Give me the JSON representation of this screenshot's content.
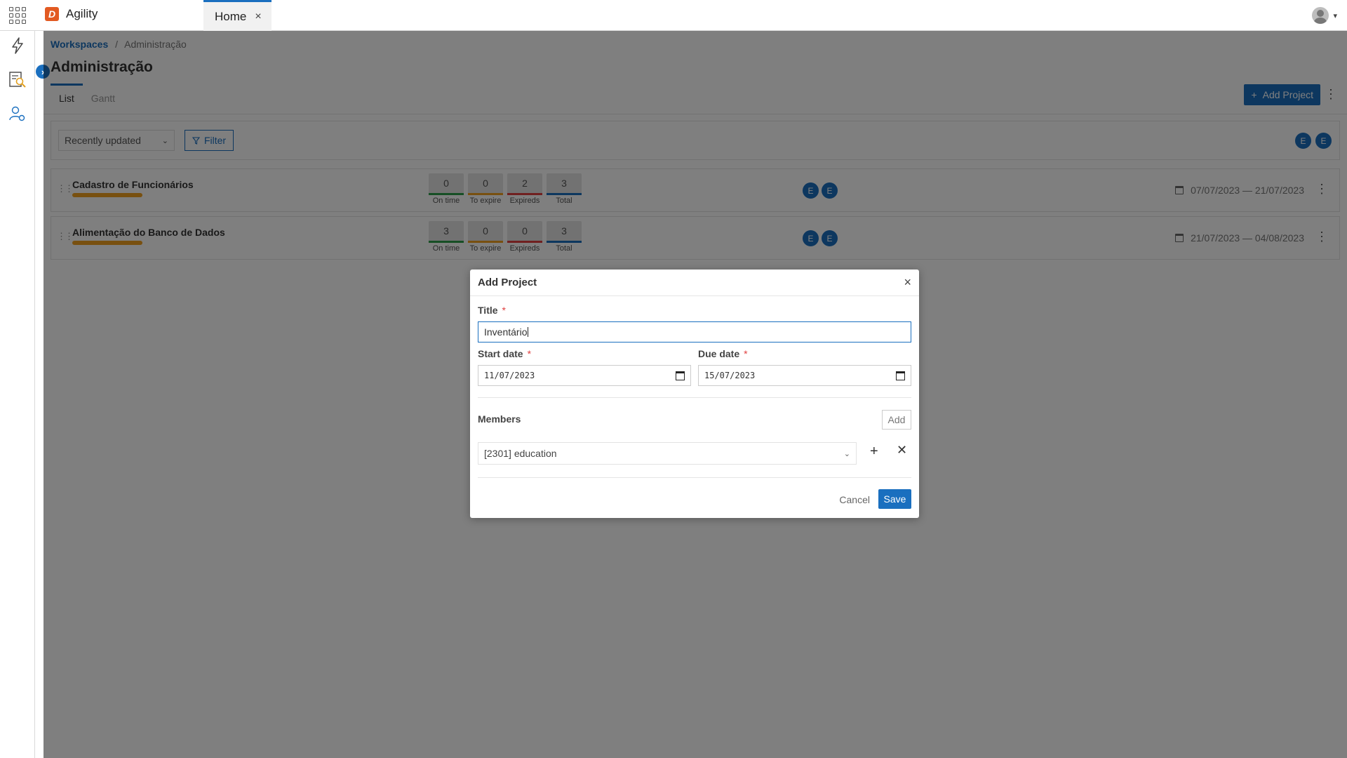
{
  "app": {
    "name": "Agility",
    "logo_letter": "D"
  },
  "tabs": [
    {
      "label": "Home",
      "close": "×"
    }
  ],
  "breadcrumb": {
    "link": "Workspaces",
    "separator": "/",
    "current": "Administração"
  },
  "page": {
    "title": "Administração"
  },
  "view_tabs": {
    "list": "List",
    "gantt": "Gantt"
  },
  "actions": {
    "add_project": "Add Project",
    "add_project_icon": "+",
    "kebab": "⋮"
  },
  "toolbar": {
    "sort_value": "Recently updated",
    "filter_label": "Filter",
    "avatars": [
      "E",
      "E"
    ]
  },
  "stat_labels": {
    "on_time": "On time",
    "to_expire": "To expire",
    "expireds": "Expireds",
    "total": "Total"
  },
  "stat_colors": {
    "on_time": "#2e9e4a",
    "to_expire": "#f0a020",
    "expireds": "#e04040",
    "total": "#1a6fbf"
  },
  "projects": [
    {
      "name": "Cadastro de Funcionários",
      "stats": {
        "on_time": "0",
        "to_expire": "0",
        "expireds": "2",
        "total": "3"
      },
      "avatars": [
        "E",
        "E"
      ],
      "dates": "07/07/2023 — 21/07/2023"
    },
    {
      "name": "Alimentação do Banco de Dados",
      "stats": {
        "on_time": "3",
        "to_expire": "0",
        "expireds": "0",
        "total": "3"
      },
      "avatars": [
        "E",
        "E"
      ],
      "dates": "21/07/2023 — 04/08/2023"
    }
  ],
  "modal": {
    "title": "Add Project",
    "close": "×",
    "title_label": "Title",
    "required_mark": "*",
    "title_value": "Inventário",
    "start_date_label": "Start date",
    "start_date_value": "11/07/2023",
    "due_date_label": "Due date",
    "due_date_value": "15/07/2023",
    "members_label": "Members",
    "add_label": "Add",
    "member_value": "[2301] education",
    "member_add": "+",
    "member_remove": "✕",
    "cancel_label": "Cancel",
    "save_label": "Save"
  },
  "colors": {
    "accent": "#1a6fbf",
    "brand": "#e25a22",
    "progress": "#f0a020"
  }
}
